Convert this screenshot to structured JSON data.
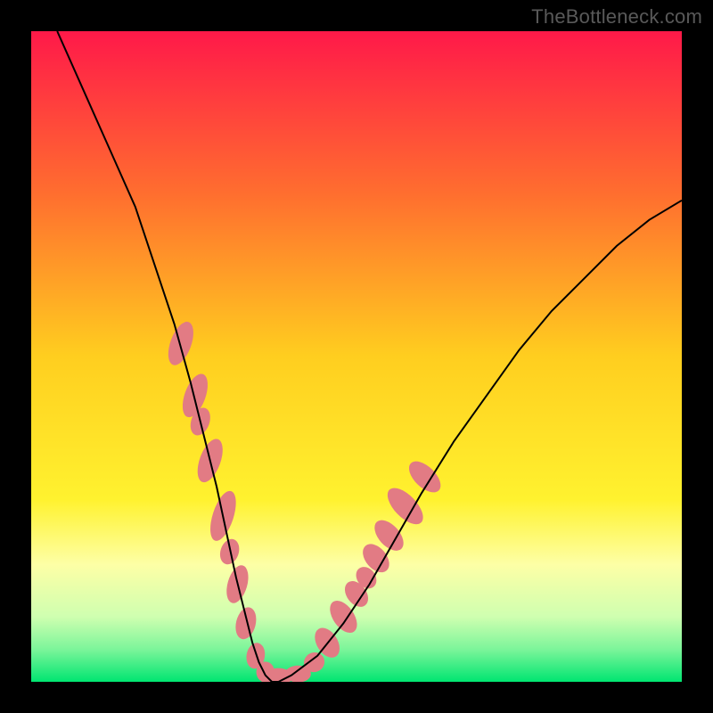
{
  "watermark": "TheBottleneck.com",
  "chart_data": {
    "type": "line",
    "title": "",
    "xlabel": "",
    "ylabel": "",
    "xlim": [
      0,
      100
    ],
    "ylim": [
      0,
      100
    ],
    "series": [
      {
        "name": "curve",
        "x": [
          4,
          8,
          12,
          16,
          19,
          22,
          24.5,
          26.5,
          28.5,
          30,
          31.5,
          33,
          34,
          35,
          36,
          37,
          38,
          40,
          44,
          48,
          52,
          56,
          60,
          65,
          70,
          75,
          80,
          85,
          90,
          95,
          100
        ],
        "y": [
          100,
          91,
          82,
          73,
          64,
          55,
          46,
          38,
          30,
          23,
          16,
          10,
          6,
          3,
          1,
          0,
          0,
          1,
          4,
          9,
          15,
          22,
          29,
          37,
          44,
          51,
          57,
          62,
          67,
          71,
          74
        ],
        "stroke": "#000000"
      }
    ],
    "annotations": {
      "gradient_stops": [
        {
          "offset": 0.0,
          "color": "#ff1949"
        },
        {
          "offset": 0.25,
          "color": "#ff6e2f"
        },
        {
          "offset": 0.5,
          "color": "#ffce1f"
        },
        {
          "offset": 0.72,
          "color": "#fff22f"
        },
        {
          "offset": 0.82,
          "color": "#fdffa6"
        },
        {
          "offset": 0.9,
          "color": "#cfffb0"
        },
        {
          "offset": 0.95,
          "color": "#7cf59a"
        },
        {
          "offset": 1.0,
          "color": "#00e571"
        }
      ],
      "blob_segments": [
        {
          "cx": 23.0,
          "cy": 52.0,
          "rx": 1.6,
          "ry": 3.5,
          "rot": 20
        },
        {
          "cx": 25.2,
          "cy": 44.0,
          "rx": 1.6,
          "ry": 3.5,
          "rot": 20
        },
        {
          "cx": 26.0,
          "cy": 40.0,
          "rx": 1.4,
          "ry": 2.2,
          "rot": 20
        },
        {
          "cx": 27.5,
          "cy": 34.0,
          "rx": 1.6,
          "ry": 3.5,
          "rot": 20
        },
        {
          "cx": 29.5,
          "cy": 25.5,
          "rx": 1.6,
          "ry": 4.0,
          "rot": 18
        },
        {
          "cx": 30.5,
          "cy": 20.0,
          "rx": 1.4,
          "ry": 2.0,
          "rot": 18
        },
        {
          "cx": 31.7,
          "cy": 15.0,
          "rx": 1.5,
          "ry": 3.0,
          "rot": 16
        },
        {
          "cx": 33.0,
          "cy": 9.0,
          "rx": 1.5,
          "ry": 2.5,
          "rot": 14
        },
        {
          "cx": 34.5,
          "cy": 4.0,
          "rx": 1.4,
          "ry": 2.0,
          "rot": 10
        },
        {
          "cx": 36.0,
          "cy": 1.5,
          "rx": 1.4,
          "ry": 1.6,
          "rot": 0
        },
        {
          "cx": 38.0,
          "cy": 0.8,
          "rx": 2.2,
          "ry": 1.3,
          "rot": 0
        },
        {
          "cx": 41.0,
          "cy": 1.2,
          "rx": 2.0,
          "ry": 1.3,
          "rot": 0
        },
        {
          "cx": 43.5,
          "cy": 3.0,
          "rx": 1.6,
          "ry": 1.5,
          "rot": -25
        },
        {
          "cx": 45.5,
          "cy": 6.0,
          "rx": 1.6,
          "ry": 2.5,
          "rot": -32
        },
        {
          "cx": 48.0,
          "cy": 10.0,
          "rx": 1.6,
          "ry": 2.8,
          "rot": -35
        },
        {
          "cx": 50.0,
          "cy": 13.5,
          "rx": 1.5,
          "ry": 2.2,
          "rot": -37
        },
        {
          "cx": 51.5,
          "cy": 16.0,
          "rx": 1.4,
          "ry": 1.8,
          "rot": -38
        },
        {
          "cx": 53.0,
          "cy": 19.0,
          "rx": 1.6,
          "ry": 2.5,
          "rot": -40
        },
        {
          "cx": 55.0,
          "cy": 22.5,
          "rx": 1.6,
          "ry": 2.8,
          "rot": -42
        },
        {
          "cx": 57.5,
          "cy": 27.0,
          "rx": 1.7,
          "ry": 3.5,
          "rot": -44
        },
        {
          "cx": 60.5,
          "cy": 31.5,
          "rx": 1.6,
          "ry": 3.0,
          "rot": -46
        }
      ],
      "blob_color": "#e27b84"
    }
  }
}
